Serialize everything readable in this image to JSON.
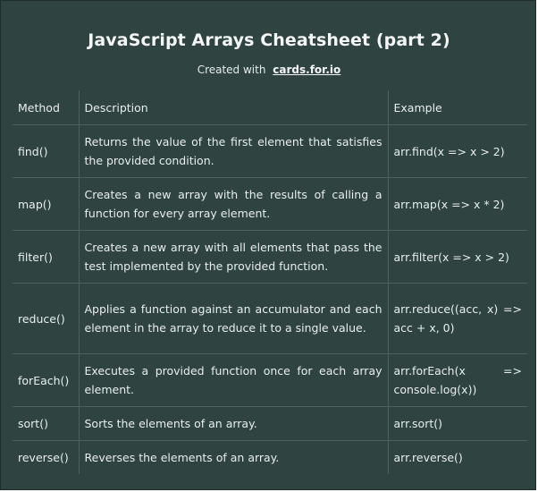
{
  "header": {
    "title": "JavaScript Arrays Cheatsheet (part 2)",
    "subtitle_prefix": "Created with",
    "subtitle_link": "cards.for.io"
  },
  "table": {
    "columns": [
      "Method",
      "Description",
      "Example"
    ],
    "rows": [
      {
        "method": "find()",
        "description": "Returns the value of the first element that satisfies the provided condition.",
        "example": "arr.find(x => x > 2)"
      },
      {
        "method": "map()",
        "description": "Creates a new array with the results of calling a function for every array element.",
        "example": "arr.map(x => x * 2)"
      },
      {
        "method": "filter()",
        "description": "Creates a new array with all elements that pass the test implemented by the provided function.",
        "example": "arr.filter(x => x > 2)"
      },
      {
        "method": "reduce()",
        "description": "Applies a function against an accumulator and each element in the array to reduce it to a single value.",
        "example": "arr.reduce((acc, x) => acc + x, 0)"
      },
      {
        "method": "forEach()",
        "description": "Executes a provided function once for each array element.",
        "example": "arr.forEach(x => console.log(x))"
      },
      {
        "method": "sort()",
        "description": "Sorts the elements of an array.",
        "example": "arr.sort()"
      },
      {
        "method": "reverse()",
        "description": "Reverses the elements of an array.",
        "example": "arr.reverse()"
      }
    ]
  },
  "colors": {
    "card_background": "#2f4341",
    "grid_line": "#4c605e",
    "text": "#e9eeed"
  }
}
